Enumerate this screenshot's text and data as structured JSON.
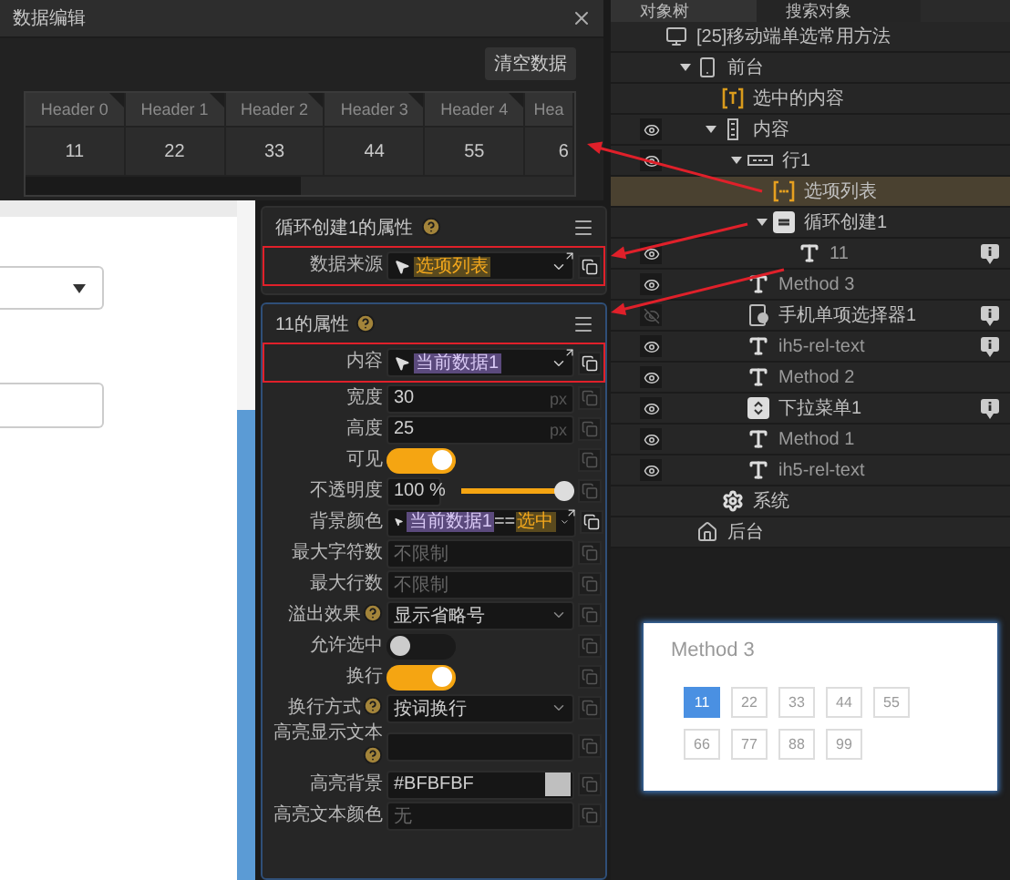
{
  "dialog": {
    "title": "数据编辑",
    "clear_button": "清空数据",
    "table": {
      "columns": [
        "Header 0",
        "Header 1",
        "Header 2",
        "Header 3",
        "Header 4",
        "Hea"
      ],
      "rows": [
        [
          "11",
          "22",
          "33",
          "44",
          "55",
          "6"
        ]
      ]
    }
  },
  "panels": [
    {
      "title": "循环创建1的属性",
      "active": false,
      "rows": [
        {
          "kind": "binding",
          "label": "数据来源",
          "help": false,
          "outlined": true,
          "parts": [
            {
              "kind": "value",
              "text": "选项列表"
            }
          ]
        }
      ]
    },
    {
      "title": "11的属性",
      "active": true,
      "rows": [
        {
          "kind": "binding",
          "label": "内容",
          "help": false,
          "outlined": true,
          "parts": [
            {
              "kind": "variable",
              "text": "当前数据1"
            }
          ]
        },
        {
          "kind": "number",
          "label": "宽度",
          "help": false,
          "outlined": false,
          "value": "30",
          "unit": "px"
        },
        {
          "kind": "number",
          "label": "高度",
          "help": false,
          "outlined": false,
          "value": "25",
          "unit": "px"
        },
        {
          "kind": "toggle",
          "label": "可见",
          "help": false,
          "outlined": false,
          "on": true
        },
        {
          "kind": "slider",
          "label": "不透明度",
          "help": false,
          "outlined": false,
          "value": "100 %",
          "level": 1
        },
        {
          "kind": "binding",
          "label": "背景颜色",
          "help": false,
          "outlined": false,
          "parts": [
            {
              "kind": "variable",
              "text": "当前数据1"
            },
            {
              "kind": "operator",
              "text": "=="
            },
            {
              "kind": "value",
              "text": "选中"
            }
          ]
        },
        {
          "kind": "text",
          "label": "最大字符数",
          "help": false,
          "outlined": false,
          "placeholder": "不限制"
        },
        {
          "kind": "text",
          "label": "最大行数",
          "help": false,
          "outlined": false,
          "placeholder": "不限制"
        },
        {
          "kind": "select",
          "label": "溢出效果",
          "help": true,
          "outlined": false,
          "value": "显示省略号"
        },
        {
          "kind": "toggle",
          "label": "允许选中",
          "help": false,
          "outlined": false,
          "on": false
        },
        {
          "kind": "toggle",
          "label": "换行",
          "help": false,
          "outlined": false,
          "on": true
        },
        {
          "kind": "select",
          "label": "换行方式",
          "help": true,
          "outlined": false,
          "value": "按词换行"
        },
        {
          "kind": "text",
          "label": "高亮显示文本",
          "help": true,
          "outlined": false
        },
        {
          "kind": "color",
          "label": "高亮背景",
          "help": false,
          "outlined": false,
          "value": "#BFBFBF",
          "color": "#bfbfbf"
        },
        {
          "kind": "text",
          "label": "高亮文本颜色",
          "help": false,
          "outlined": false,
          "placeholder": "无"
        }
      ]
    }
  ],
  "tree": {
    "tabs": [
      {
        "label": "对象树",
        "selected": true
      },
      {
        "label": "搜索对象",
        "selected": false
      }
    ],
    "nodes": [
      {
        "name": "[25]移动端单选常用方法",
        "kind": "page",
        "selected": false,
        "info": false,
        "children": [
          {
            "name": "前台",
            "kind": "phone",
            "expanded": true,
            "selected": false,
            "info": false,
            "children": [
              {
                "name": "选中的内容",
                "kind": "text-frame",
                "selected": false,
                "info": false
              },
              {
                "name": "内容",
                "kind": "column",
                "visible": true,
                "expanded": true,
                "selected": false,
                "info": false,
                "children": [
                  {
                    "name": "行1",
                    "kind": "row",
                    "visible": true,
                    "expanded": true,
                    "selected": false,
                    "info": false,
                    "children": [
                      {
                        "name": "选项列表",
                        "kind": "list",
                        "selected": true,
                        "info": false
                      },
                      {
                        "name": "循环创建1",
                        "kind": "loop",
                        "expanded": true,
                        "selected": false,
                        "info": false,
                        "children": [
                          {
                            "name": "11",
                            "kind": "text",
                            "visible": true,
                            "selected": false,
                            "info": true
                          }
                        ]
                      }
                    ]
                  },
                  {
                    "name": "Method 3",
                    "kind": "text",
                    "visible": true,
                    "selected": false,
                    "info": false
                  },
                  {
                    "name": "手机单项选择器1",
                    "kind": "picker",
                    "visible": false,
                    "selected": false,
                    "info": true
                  },
                  {
                    "name": "ih5-rel-text",
                    "kind": "text",
                    "visible": true,
                    "selected": false,
                    "info": true
                  },
                  {
                    "name": "Method 2",
                    "kind": "text",
                    "visible": true,
                    "selected": false,
                    "info": false
                  },
                  {
                    "name": "下拉菜单1",
                    "kind": "dropdown",
                    "visible": true,
                    "selected": false,
                    "info": true
                  },
                  {
                    "name": "Method 1",
                    "kind": "text",
                    "visible": true,
                    "selected": false,
                    "info": false
                  },
                  {
                    "name": "ih5-rel-text",
                    "kind": "text",
                    "visible": true,
                    "selected": false,
                    "info": false
                  }
                ]
              },
              {
                "name": "系统",
                "kind": "gear",
                "selected": false,
                "info": false
              }
            ]
          },
          {
            "name": "后台",
            "kind": "home",
            "selected": false,
            "info": false
          }
        ]
      }
    ]
  },
  "preview": {
    "title": "Method 3",
    "options": [
      {
        "label": "11",
        "selected": true
      },
      {
        "label": "22",
        "selected": false
      },
      {
        "label": "33",
        "selected": false
      },
      {
        "label": "44",
        "selected": false
      },
      {
        "label": "55",
        "selected": false
      },
      {
        "label": "66",
        "selected": false
      },
      {
        "label": "77",
        "selected": false
      },
      {
        "label": "88",
        "selected": false
      },
      {
        "label": "99",
        "selected": false
      }
    ]
  }
}
